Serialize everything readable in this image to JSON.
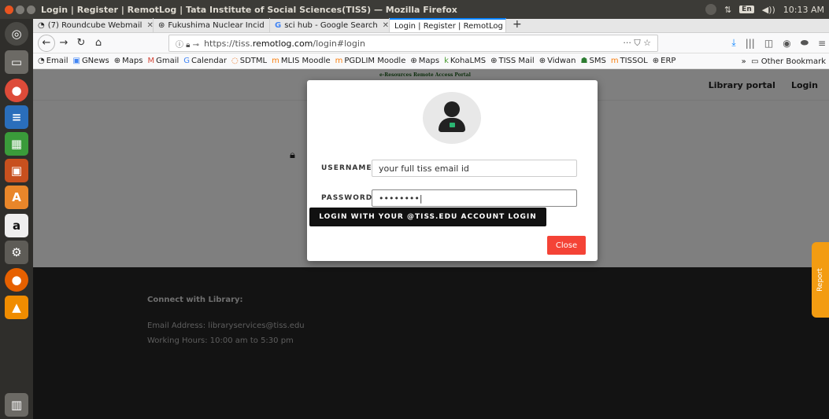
{
  "window": {
    "title": "Login | Register | RemotLog | Tata Institute of Social Sciences(TISS) — Mozilla Firefox",
    "time": "10:13 AM",
    "lang": "En"
  },
  "tabs": [
    {
      "label": "(7) Roundcube Webmail",
      "icon": "roundcube-icon"
    },
    {
      "label": "Fukushima Nuclear Incid",
      "icon": "sci-hub-icon"
    },
    {
      "label": "sci hub - Google Search",
      "icon": "google-icon"
    },
    {
      "label": "Login | Register | RemotLog",
      "icon": "none",
      "active": true
    }
  ],
  "nav": {
    "url_prefix": "https://tiss.",
    "url_host": "remotlog.com",
    "url_suffix": "/login#login",
    "url_actions": "··· ⛉ ☆"
  },
  "bookmarks": [
    "Email",
    "GNews",
    "Maps",
    "Gmail",
    "Calendar",
    "SDTML",
    "MLIS Moodle",
    "PGDLIM Moodle",
    "Maps",
    "KohaLMS",
    "TISS Mail",
    "Vidwan",
    "SMS",
    "TISSOL",
    "ERP"
  ],
  "bookmarks_other": "Other Bookmark",
  "site": {
    "portal_title": "e-Resources Remote Access Portal",
    "nav_library": "Library portal",
    "nav_login": "Login",
    "footer_heading": "Connect with Library:",
    "footer_email": "Email Address:  libraryservices@tiss.edu",
    "footer_hours": "Working Hours: 10:00 am to 5:30 pm",
    "report": "Report"
  },
  "modal": {
    "username_label": "USERNAME:",
    "username_value": "your full tiss email id",
    "password_label": "PASSWORD:",
    "password_value": "••••••••|",
    "login_button": "LOGIN WITH YOUR @TISS.EDU ACCOUNT LOGIN",
    "close_button": "Close"
  },
  "colors": {
    "accent_tab": "#0a84ff",
    "close_red": "#f44336",
    "report_orange": "#f39c12"
  }
}
